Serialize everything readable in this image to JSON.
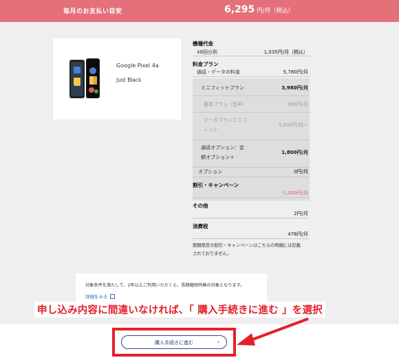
{
  "header": {
    "label": "毎月のお支払い目安",
    "amount": "6,295",
    "unit": "円/月（税込）"
  },
  "product": {
    "name": "Google Pixel 4a",
    "color": "Just Black"
  },
  "breakdown": {
    "device_title": "機種代金",
    "installment_label": "48回分割",
    "installment_value": "1,035円/月（税込）",
    "plan_title": "料金プラン",
    "voice_data_label": "通話・データの料金",
    "voice_data_value": "5,780円/月",
    "mini_fit_label": "ミニフィットプラン",
    "mini_fit_value": "3,980円/月",
    "basic_label": "基本プラン（音声）",
    "basic_value": "980円/月",
    "data_mini_label_1": "データプランミニフ",
    "data_mini_label_2": "ィット",
    "data_mini_value": "3,000円/月〜",
    "call_option_label_1": "通話オプション：定",
    "call_option_label_2": "額オプション＋",
    "call_option_value": "1,800円/月",
    "option_label": "オプション",
    "option_value": "0円/月",
    "discount_title": "割引・キャンペーン",
    "discount_value": "-1,000円/月",
    "other_title": "その他",
    "other_value": "2円/月",
    "tax_title": "消費税",
    "tax_value": "478円/月",
    "note_1": "期間限定の割引・キャンペーンはこちらの明細には記載",
    "note_2": "されておりません。"
  },
  "terms": {
    "text": "対象条件を満たして、2年以上ご利用いただくと、長期継続特典の対象となります。",
    "link": "詳細をみる"
  },
  "annotation": "申し込み内容に間違いなければ、「 購入手続きに進む 」を選択",
  "cta": {
    "label": "購入手続きに進む",
    "chevron": "›"
  },
  "colors": {
    "header_bg": "#e4707a",
    "annotation_red": "#e4202a",
    "link_blue": "#2b6cc2",
    "discount_red": "#e05a6a"
  }
}
